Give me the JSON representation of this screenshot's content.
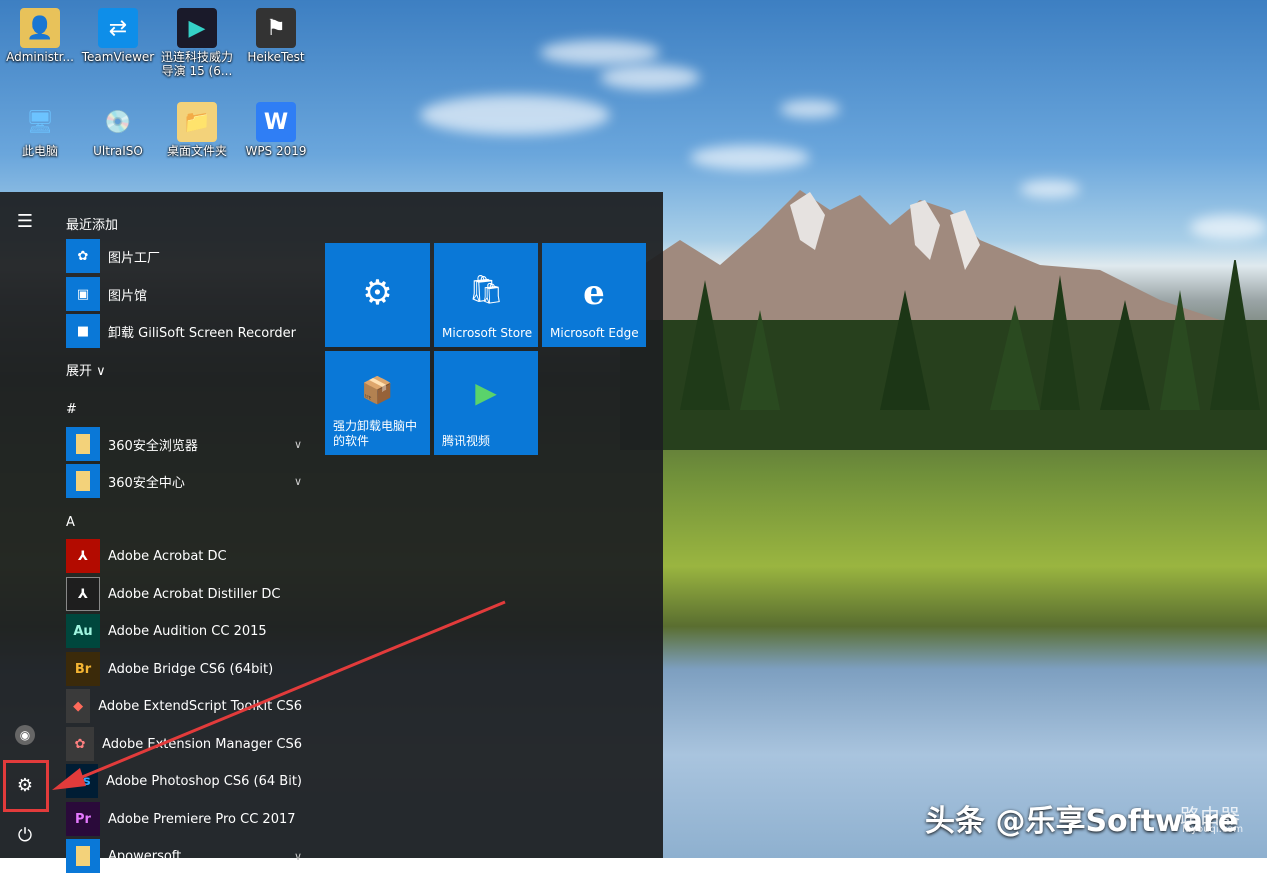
{
  "desktop": {
    "icons": [
      {
        "label": "Administr...",
        "icon": "user-folder-icon",
        "color": "#e8c25a"
      },
      {
        "label": "TeamViewer",
        "icon": "teamviewer-icon",
        "color": "#0e8ee9"
      },
      {
        "label": "迅连科技威力导演 15 (6...",
        "icon": "powerdirector-icon",
        "color": "#1a1a2a"
      },
      {
        "label": "HeikeTest",
        "icon": "heiketest-icon",
        "color": "#333333"
      },
      {
        "label": "此电脑",
        "icon": "computer-icon",
        "color": "#3a9ad9"
      },
      {
        "label": "UltraISO",
        "icon": "disc-icon",
        "color": "#c0c0c0"
      },
      {
        "label": "桌面文件夹",
        "icon": "folder-icon",
        "color": "#f3d27a"
      },
      {
        "label": "WPS 2019",
        "icon": "wps-icon",
        "color": "#2f7ef5"
      }
    ]
  },
  "start_menu": {
    "menu_icon": "hamburger-icon",
    "user_icon": "user-icon",
    "settings_icon": "gear-icon",
    "power_icon": "power-icon",
    "recent_header": "最近添加",
    "recent": [
      {
        "label": "图片工厂",
        "icon": "picture-factory-icon"
      },
      {
        "label": "图片馆",
        "icon": "picture-gallery-icon"
      },
      {
        "label": "卸载 GiliSoft Screen Recorder",
        "icon": "screen-recorder-icon"
      }
    ],
    "expand_label": "展开 ∨",
    "hash_header": "#",
    "hash_items": [
      {
        "label": "360安全浏览器",
        "icon": "folder-icon",
        "chev": "∨"
      },
      {
        "label": "360安全中心",
        "icon": "folder-icon",
        "chev": "∨"
      }
    ],
    "a_header": "A",
    "a_items": [
      {
        "label": "Adobe Acrobat DC",
        "badge": "⅄",
        "bg": "#b30b00"
      },
      {
        "label": "Adobe Acrobat Distiller DC",
        "badge": "⅄",
        "bg": "#1e1e1e"
      },
      {
        "label": "Adobe Audition CC 2015",
        "badge": "Au",
        "bg": "#00473d"
      },
      {
        "label": "Adobe Bridge CS6 (64bit)",
        "badge": "Br",
        "bg": "#3b2a0a"
      },
      {
        "label": "Adobe ExtendScript Toolkit CS6",
        "badge": "◆",
        "bg": "#3a3a3a"
      },
      {
        "label": "Adobe Extension Manager CS6",
        "badge": "✿",
        "bg": "#3a3a3a"
      },
      {
        "label": "Adobe Photoshop CS6 (64 Bit)",
        "badge": "Ps",
        "bg": "#001d34"
      },
      {
        "label": "Adobe Premiere Pro CC 2017",
        "badge": "Pr",
        "bg": "#2a0a3a"
      },
      {
        "label": "Apowersoft",
        "badge": "",
        "bg": "#0a78d7",
        "chev": "∨"
      }
    ],
    "tiles": [
      {
        "label": "",
        "glyph": "⚙",
        "icon": "settings-tile-icon"
      },
      {
        "label": "Microsoft Store",
        "glyph": "🛍",
        "icon": "store-icon"
      },
      {
        "label": "Microsoft Edge",
        "glyph": "e",
        "icon": "edge-icon"
      },
      {
        "label": "强力卸载电脑中的软件",
        "glyph": "📦",
        "icon": "uninstall-icon"
      },
      {
        "label": "腾讯视频",
        "glyph": "▶",
        "icon": "tencent-video-icon"
      }
    ]
  },
  "watermark": {
    "main": "头条 @乐享Software",
    "site_cn": "路由器",
    "site_url": "luyouqi.com"
  },
  "colors": {
    "tile": "#0a78d7",
    "highlight": "#e23b3b",
    "arrow": "#e23b3b"
  }
}
